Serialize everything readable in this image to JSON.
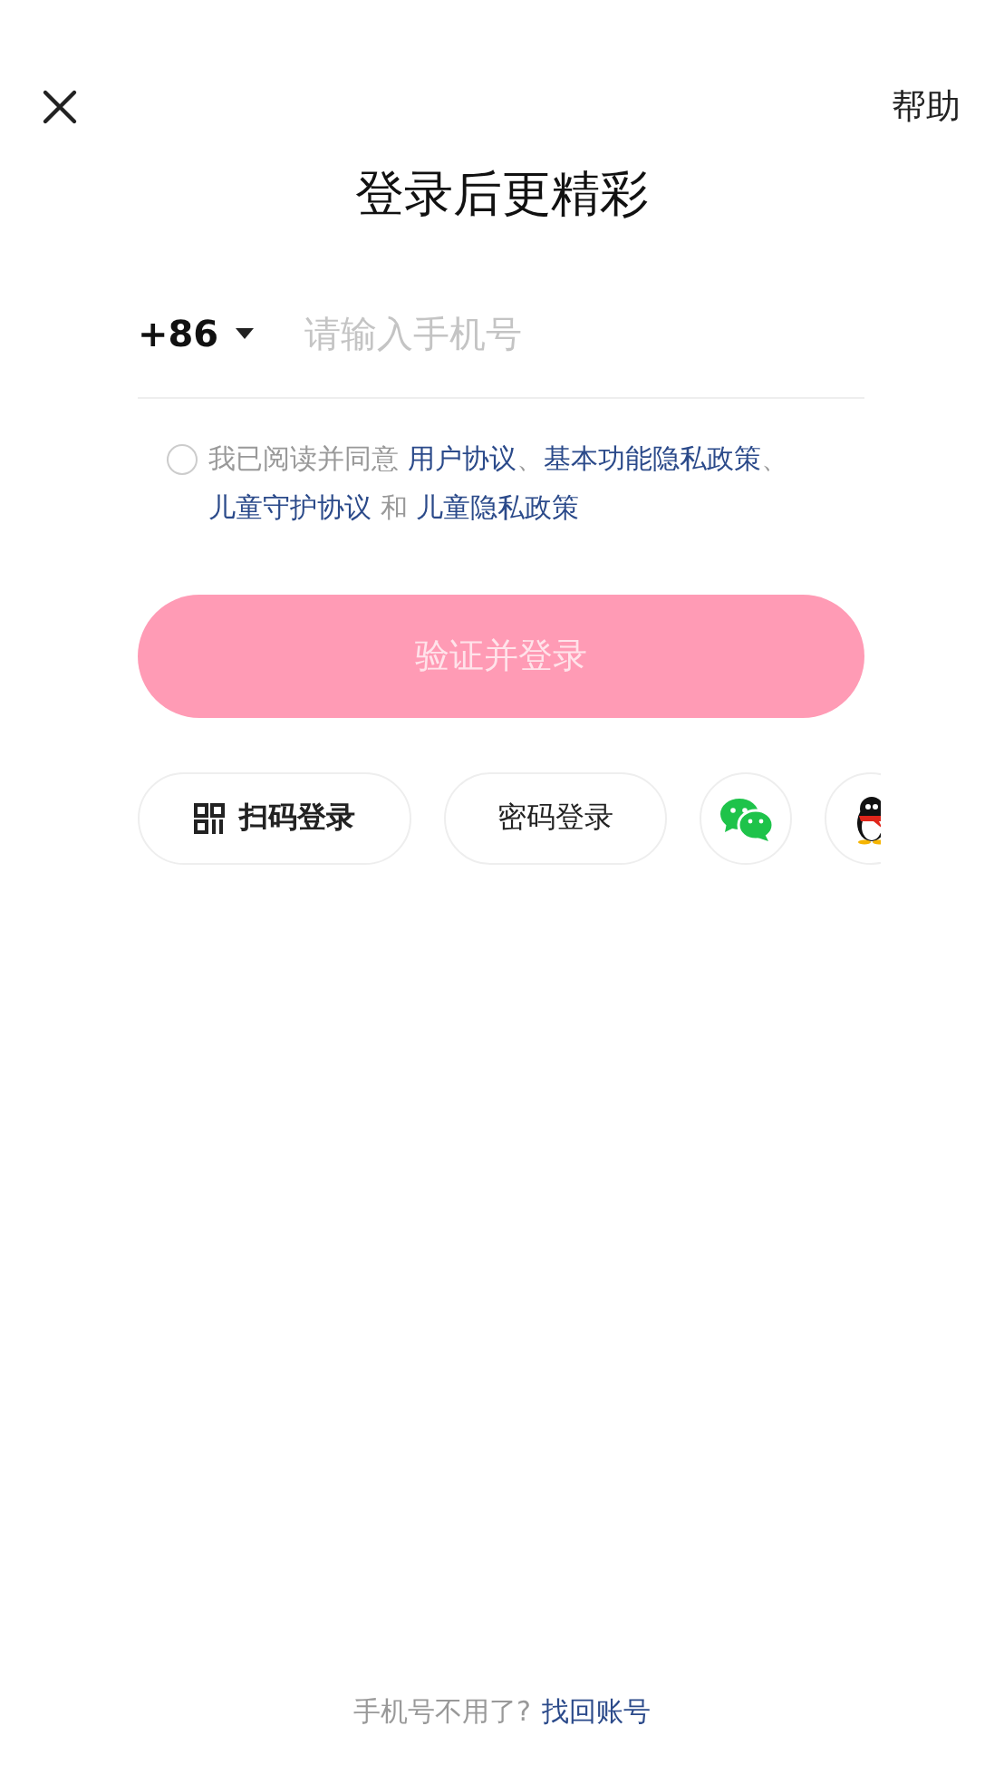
{
  "header": {
    "help": "帮助"
  },
  "title": "登录后更精彩",
  "phone": {
    "country_code": "+86",
    "placeholder": "请输入手机号"
  },
  "agreement": {
    "checked": false,
    "segments": [
      {
        "kind": "text",
        "text": "我已阅读并同意 "
      },
      {
        "kind": "link",
        "text": "用户协议"
      },
      {
        "kind": "text",
        "text": "、"
      },
      {
        "kind": "link",
        "text": "基本功能隐私政策"
      },
      {
        "kind": "text",
        "text": "、"
      },
      {
        "kind": "link",
        "text": "儿童守护协议"
      },
      {
        "kind": "text",
        "text": " 和 "
      },
      {
        "kind": "link",
        "text": "儿童隐私政策"
      }
    ]
  },
  "login_button": {
    "label": "验证并登录",
    "disabled": true
  },
  "alt_logins": [
    {
      "kind": "qr",
      "label": "扫码登录"
    },
    {
      "kind": "password",
      "label": "密码登录"
    },
    {
      "kind": "wechat"
    },
    {
      "kind": "qq"
    }
  ],
  "footer": {
    "text": "手机号不用了?",
    "link": "找回账号"
  }
}
